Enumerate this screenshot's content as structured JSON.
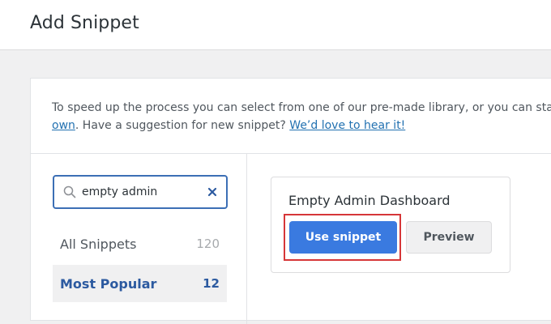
{
  "page": {
    "title": "Add Snippet"
  },
  "intro": {
    "line1": "To speed up the process you can select from one of our pre-made library, or you can start",
    "line2_link_own": "own",
    "line2_text": ". Have a suggestion for new snippet? ",
    "line2_link_feedback": "We’d love to hear it!"
  },
  "search": {
    "value": "empty admin",
    "icon": "search-icon",
    "clear_icon": "close-icon"
  },
  "categories": [
    {
      "label": "All Snippets",
      "count": "120",
      "active": false
    },
    {
      "label": "Most Popular",
      "count": "12",
      "active": true
    }
  ],
  "snippet_card": {
    "title": "Empty Admin Dashboard",
    "use_label": "Use snippet",
    "preview_label": "Preview"
  },
  "colors": {
    "accent": "#3a7ae0",
    "highlight": "#d63638",
    "link": "#2271b1"
  }
}
